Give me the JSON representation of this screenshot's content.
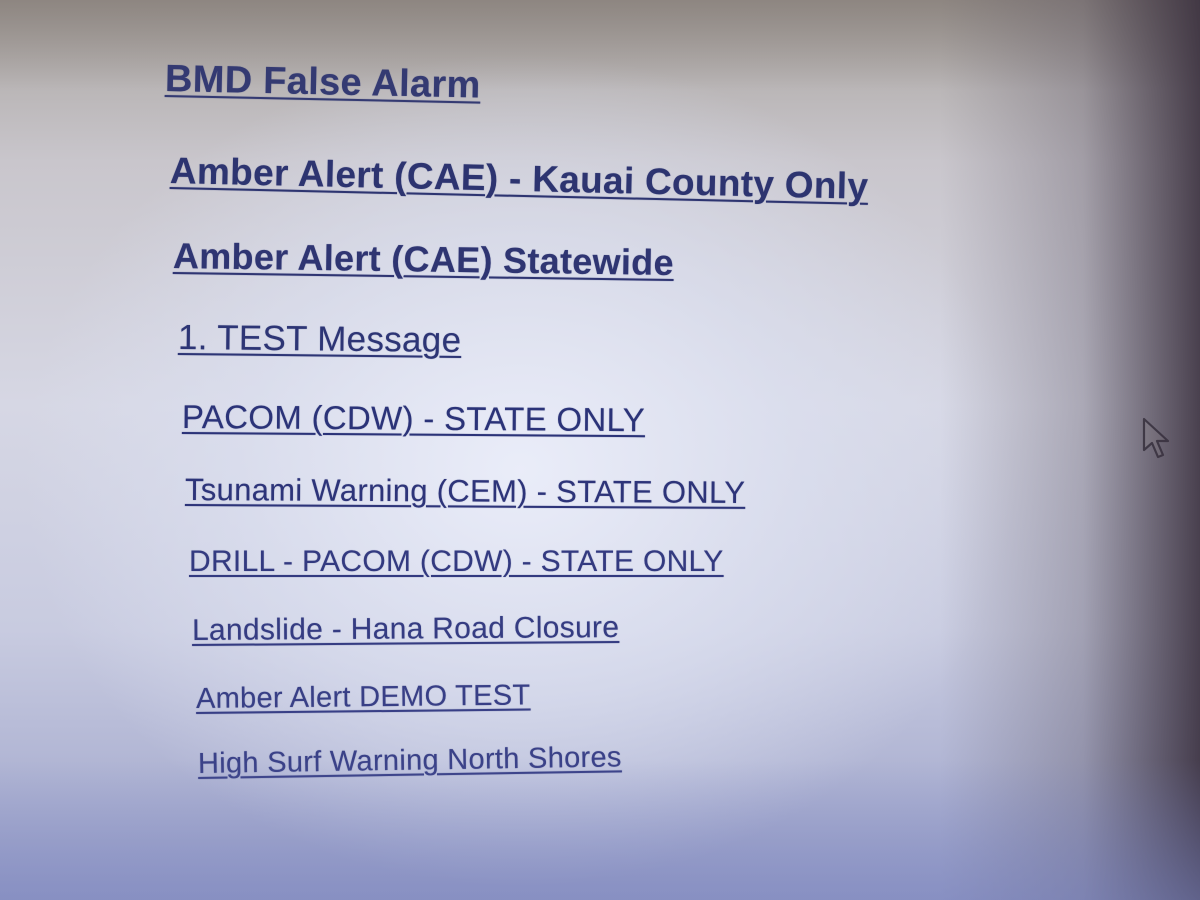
{
  "alerts": [
    {
      "label": "BMD False Alarm"
    },
    {
      "label": "Amber Alert (CAE) - Kauai County Only"
    },
    {
      "label": "Amber Alert (CAE) Statewide"
    },
    {
      "label": "1. TEST Message"
    },
    {
      "label": "PACOM (CDW) - STATE ONLY"
    },
    {
      "label": "Tsunami Warning (CEM) - STATE ONLY"
    },
    {
      "label": "DRILL - PACOM (CDW) - STATE ONLY"
    },
    {
      "label": "Landslide - Hana Road Closure"
    },
    {
      "label": "Amber Alert DEMO TEST"
    },
    {
      "label": "High Surf Warning North Shores"
    }
  ],
  "cursor": {
    "icon": "arrow-pointer-icon"
  },
  "colors": {
    "link": "#2d3470",
    "background": "#d6d7e4"
  }
}
